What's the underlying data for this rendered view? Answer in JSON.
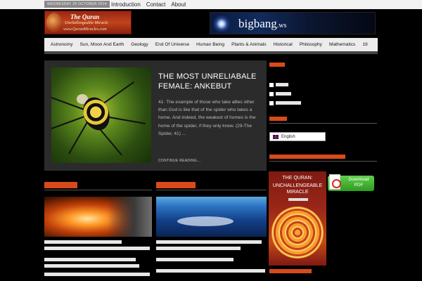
{
  "topbar": {
    "date": "WEDNESDAY 29 OCTOBER 2014",
    "links": [
      "Introduction",
      "Contact",
      "About"
    ]
  },
  "banners": {
    "quran": {
      "title": "The Quran",
      "subtitle": "Unchallengeable Miracle",
      "site": "www.QuranMiracles.com"
    },
    "bigbang": {
      "name": "bigbang",
      "tld": ".ws"
    }
  },
  "nav": {
    "items": [
      "Astronomy",
      "Sun, Moon And Earth",
      "Geology",
      "End Of Universe",
      "Human Being",
      "Plants & Animals",
      "Historical",
      "Philosophy",
      "Mathematics",
      "19"
    ]
  },
  "featured": {
    "title": "THE MOST UNRELIABALE FEMALE: ANKEBUT",
    "excerpt": "41- The example of those who take allies other than God is like that of the spider who takes a home. And indeed, the weakest of homes is the home of the spider, if they only knew.  (29-The Spider, 41) ...",
    "more": "CONTINUE READING..."
  },
  "sidebar": {
    "language": "English",
    "pdf_button": "Download PDF",
    "book": {
      "title_line1": "THE QURAN:",
      "title_line2": "UNCHALLENGEABLE MIRACLE"
    }
  },
  "colors": {
    "accent": "#d94a1a",
    "background": "#000000",
    "nav_background": "#ececec",
    "featured_background": "#2b2b2b"
  }
}
